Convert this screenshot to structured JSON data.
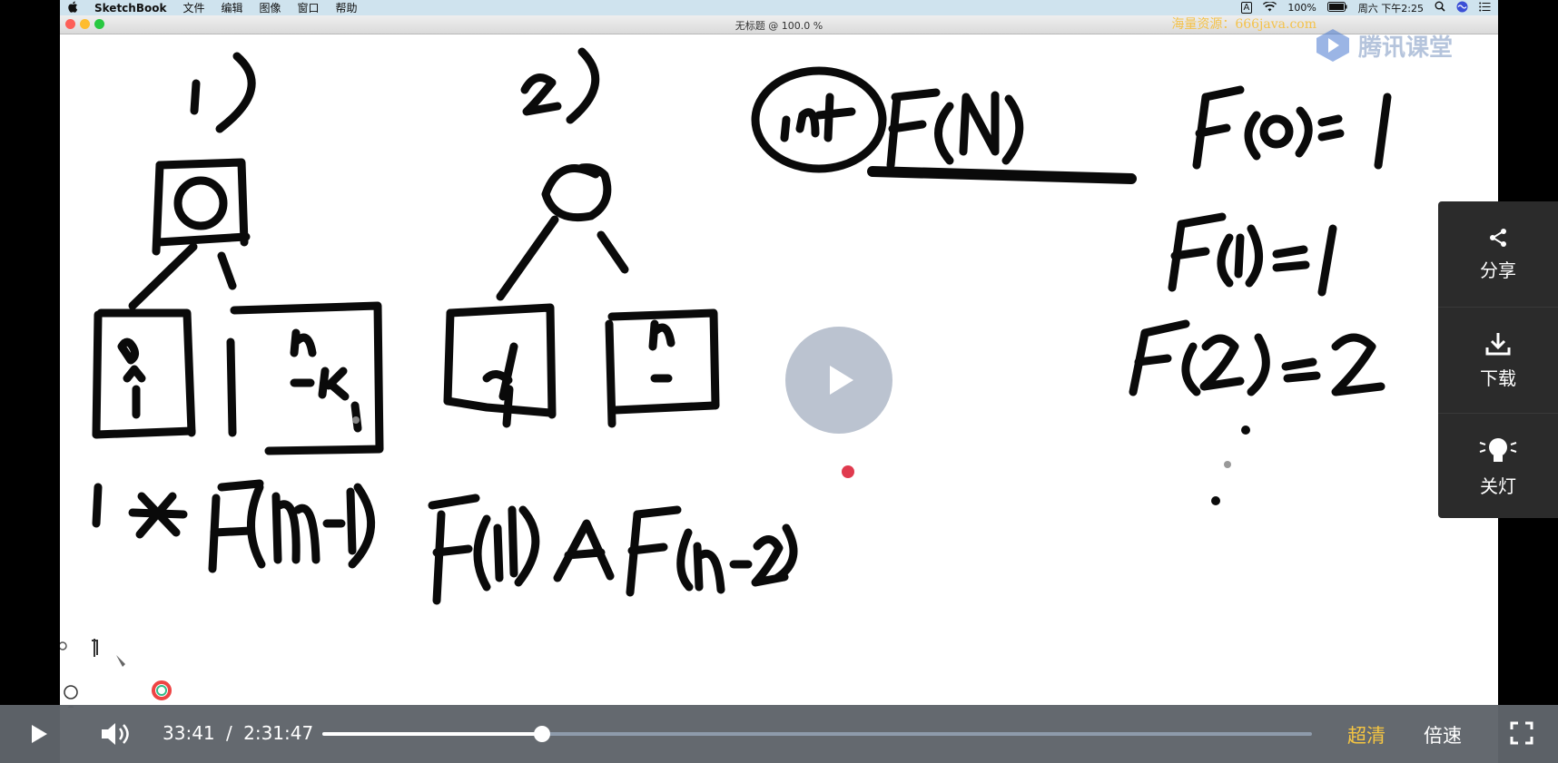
{
  "menubar": {
    "app": "SketchBook",
    "items": [
      "文件",
      "编辑",
      "图像",
      "窗口",
      "帮助"
    ],
    "input_badge": "A",
    "battery": "100%",
    "clock": "周六 下午2:25"
  },
  "window": {
    "title": "无标题 @ 100.0 %"
  },
  "watermark": {
    "text": "海量资源：666java.com",
    "brand": "腾讯课堂"
  },
  "sidepanel": {
    "share": "分享",
    "download": "下载",
    "lights_off": "关灯"
  },
  "player": {
    "current_time": "33:41",
    "separator": "/",
    "duration": "2:31:47",
    "progress_fraction": 0.2218,
    "quality": "超清",
    "speed": "倍速"
  },
  "colors": {
    "quality_accent": "#f5c542",
    "control_bar": "#5f646a",
    "menubar": "#cfe3ee"
  }
}
